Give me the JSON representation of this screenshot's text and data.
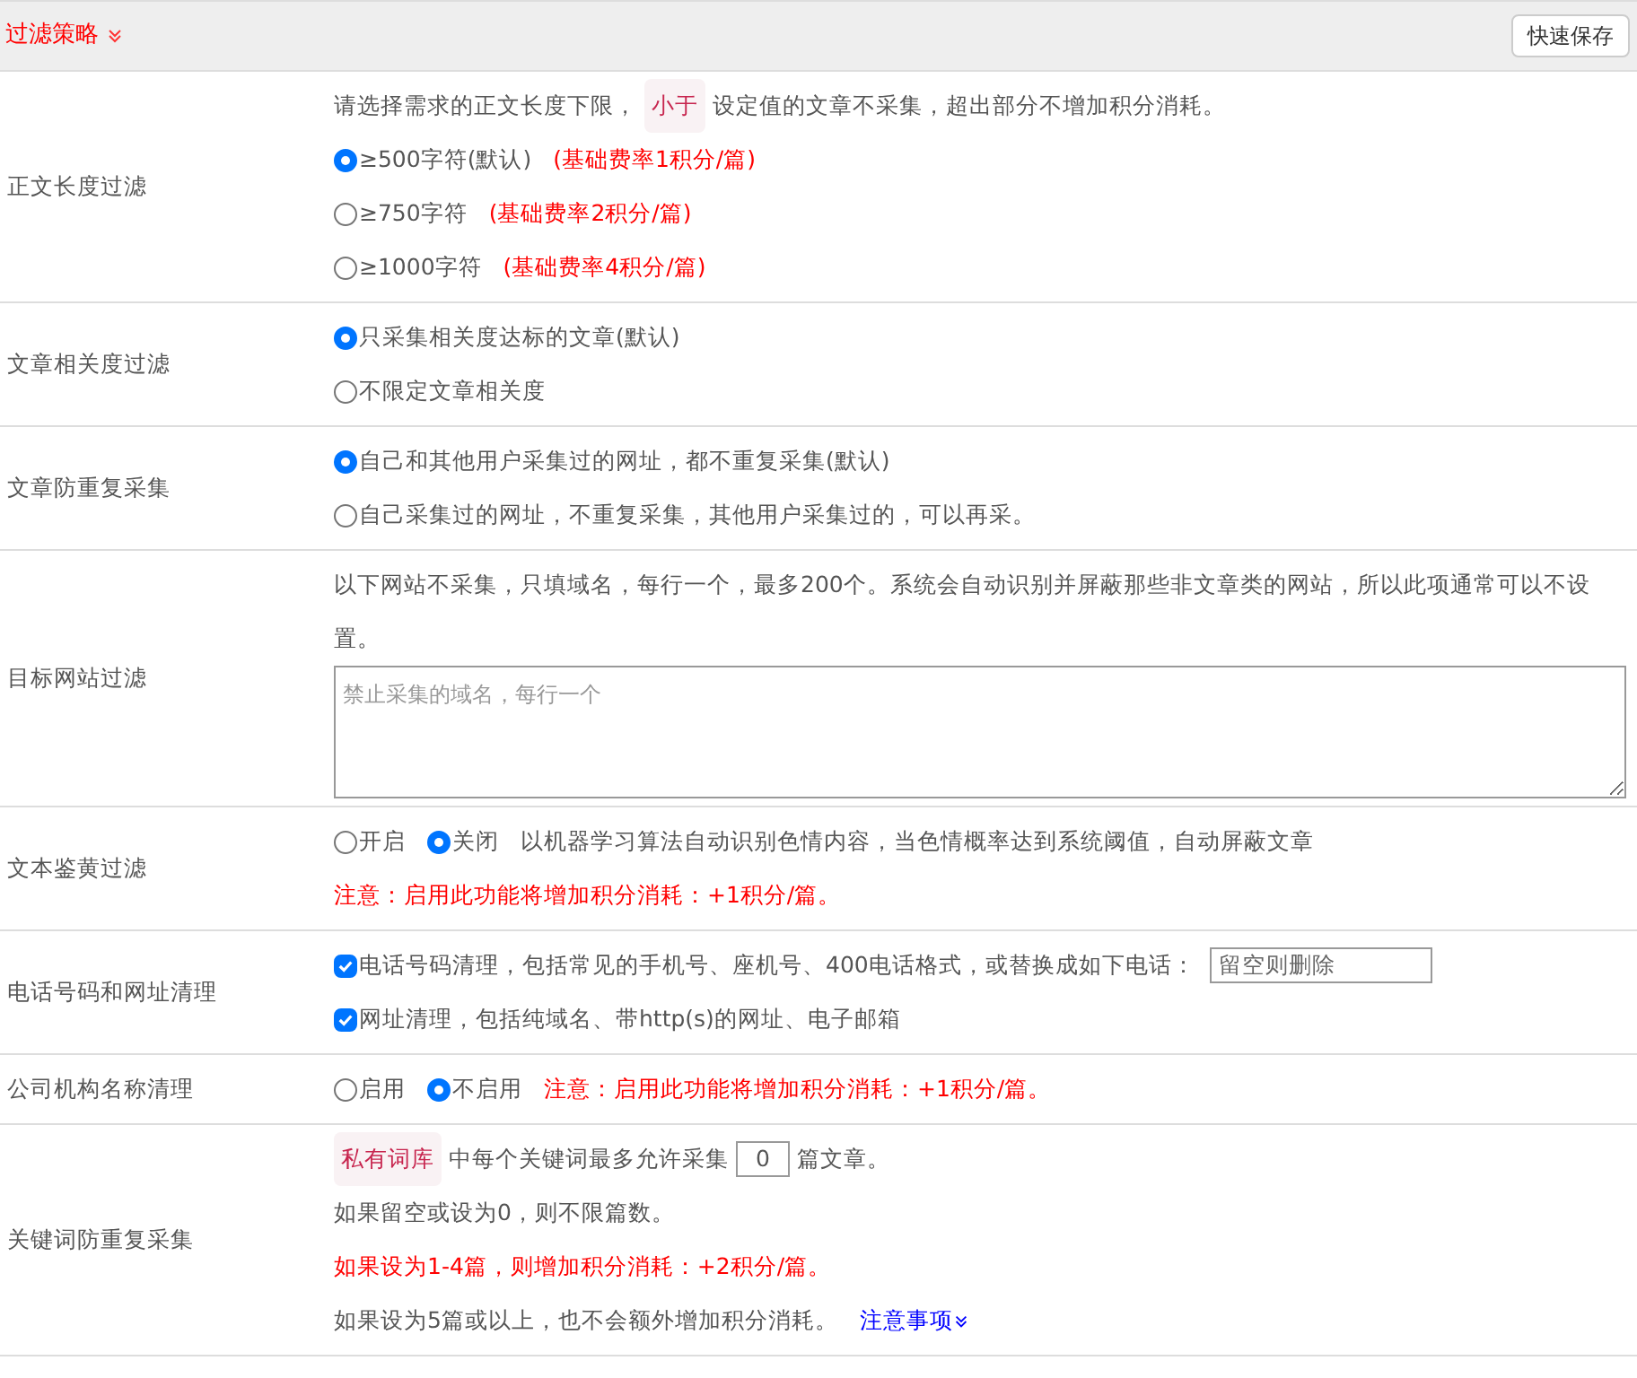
{
  "header": {
    "title": "过滤策略",
    "button": "快速保存"
  },
  "rows": [
    {
      "label": "正文长度过滤",
      "lines": [
        [
          {
            "kind": "text",
            "text": "请选择需求的正文长度下限，"
          },
          {
            "kind": "tag",
            "text": "小于"
          },
          {
            "kind": "text",
            "text": "设定值的文章不采集，超出部分不增加积分消耗。"
          }
        ],
        [
          {
            "kind": "radio",
            "text": "≥500字符(默认)",
            "selected": true
          },
          {
            "kind": "note",
            "text": "(基础费率1积分/篇)"
          }
        ],
        [
          {
            "kind": "radio",
            "text": "≥750字符",
            "selected": false
          },
          {
            "kind": "note",
            "text": "(基础费率2积分/篇)"
          }
        ],
        [
          {
            "kind": "radio",
            "text": "≥1000字符",
            "selected": false
          },
          {
            "kind": "note",
            "text": "(基础费率4积分/篇)"
          }
        ]
      ]
    },
    {
      "label": "文章相关度过滤",
      "lines": [
        [
          {
            "kind": "radio",
            "text": "只采集相关度达标的文章(默认)",
            "selected": true
          }
        ],
        [
          {
            "kind": "radio",
            "text": "不限定文章相关度",
            "selected": false
          }
        ]
      ]
    },
    {
      "label": "文章防重复采集",
      "lines": [
        [
          {
            "kind": "radio",
            "text": "自己和其他用户采集过的网址，都不重复采集(默认)",
            "selected": true
          }
        ],
        [
          {
            "kind": "radio",
            "text": "自己采集过的网址，不重复采集，其他用户采集过的，可以再采。",
            "selected": false
          }
        ]
      ]
    },
    {
      "label": "目标网站过滤",
      "lines": [
        [
          {
            "kind": "text",
            "text": "以下网站不采集，只填域名，每行一个，最多200个。系统会自动识别并屏蔽那些非文章类的网站，所以此项通常可以不设置。"
          }
        ],
        [
          {
            "kind": "textarea",
            "placeholder": "禁止采集的域名，每行一个"
          }
        ]
      ]
    },
    {
      "label": "文本鉴黄过滤",
      "lines": [
        [
          {
            "kind": "radio",
            "text": "开启",
            "selected": false
          },
          {
            "kind": "radio",
            "text": "关闭",
            "selected": true
          },
          {
            "kind": "text",
            "text": "以机器学习算法自动识别色情内容，当色情概率达到系统阈值，自动屏蔽文章"
          }
        ],
        [
          {
            "kind": "note",
            "text": "注意：启用此功能将增加积分消耗：+1积分/篇。"
          }
        ]
      ]
    },
    {
      "label": "电话号码和网址清理",
      "lines": [
        [
          {
            "kind": "checkbox",
            "text": "电话号码清理，包括常见的手机号、座机号、400电话格式，或替换成如下电话：",
            "checked": true
          },
          {
            "kind": "input",
            "placeholder": "留空则删除"
          }
        ],
        [
          {
            "kind": "checkbox",
            "text": "网址清理，包括纯域名、带http(s)的网址、电子邮箱",
            "checked": true
          }
        ]
      ]
    },
    {
      "label": "公司机构名称清理",
      "lines": [
        [
          {
            "kind": "radio",
            "text": "启用",
            "selected": false
          },
          {
            "kind": "radio",
            "text": "不启用",
            "selected": true
          },
          {
            "kind": "note",
            "text": "注意：启用此功能将增加积分消耗：+1积分/篇。"
          }
        ]
      ]
    },
    {
      "label": "关键词防重复采集",
      "lines": [
        [
          {
            "kind": "tag",
            "text": "私有词库"
          },
          {
            "kind": "text",
            "text": "中每个关键词最多允许采集"
          },
          {
            "kind": "input",
            "value": "0"
          },
          {
            "kind": "text",
            "text": "篇文章。"
          }
        ],
        [
          {
            "kind": "text",
            "text": "如果留空或设为0，则不限篇数。"
          }
        ],
        [
          {
            "kind": "note",
            "text": "如果设为1-4篇，则增加积分消耗：+2积分/篇。"
          }
        ],
        [
          {
            "kind": "text",
            "text": "如果设为5篇或以上，也不会额外增加积分消耗。"
          },
          {
            "kind": "link",
            "text": "注意事项"
          }
        ]
      ]
    }
  ]
}
